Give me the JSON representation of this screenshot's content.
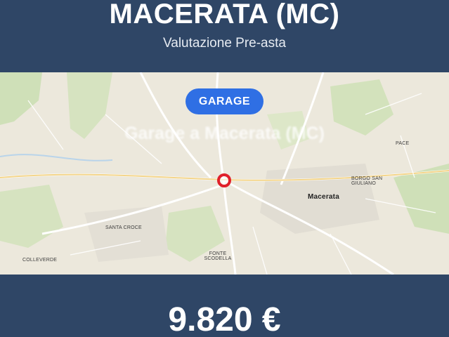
{
  "header": {
    "title": "MACERATA (MC)",
    "subtitle": "Valutazione Pre-asta"
  },
  "map": {
    "badge_label": "GARAGE",
    "overlay_title": "Garage a Macerata (MC)",
    "marker_icon": "location-pin-icon",
    "places": {
      "macerata": "Macerata",
      "santa_croce": "Santa Croce",
      "colleverde": "Colleverde",
      "borgo_san_giuliano": "Borgo San Giuliano",
      "fonte_scodella": "Fonte Scodella",
      "pace": "Pace"
    }
  },
  "footer": {
    "price": "9.820 €"
  },
  "colors": {
    "banner": "#2f4666",
    "badge": "#2f6fe4",
    "marker": "#e0202a",
    "map_background": "#ece8dc"
  }
}
